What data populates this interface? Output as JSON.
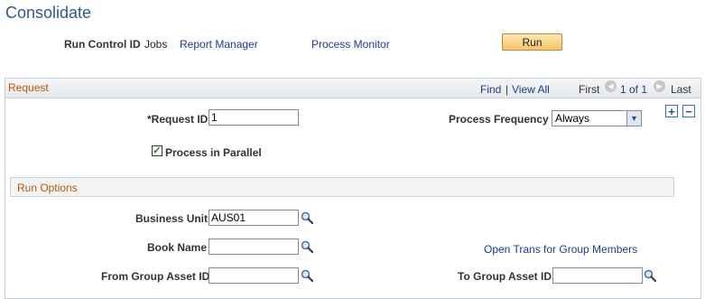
{
  "page": {
    "title": "Consolidate"
  },
  "run_bar": {
    "run_control_label": "Run Control ID",
    "run_control_value": "Jobs",
    "report_manager": "Report Manager",
    "process_monitor": "Process Monitor",
    "run_button": "Run"
  },
  "grid": {
    "title": "Request",
    "find": "Find",
    "separator": "|",
    "view_all": "View All",
    "first": "First",
    "range": "1 of 1",
    "last": "Last",
    "add_row": "+",
    "delete_row": "−"
  },
  "request": {
    "request_id_label": "*Request ID",
    "request_id_value": "1",
    "frequency_label": "Process Frequency",
    "frequency_value": "Always",
    "parallel_label": "Process in Parallel",
    "parallel_checked": true
  },
  "run_options": {
    "title": "Run Options",
    "business_unit_label": "Business Unit",
    "business_unit_value": "AUS01",
    "book_name_label": "Book Name",
    "book_name_value": "",
    "open_trans_link": "Open Trans for Group Members",
    "from_group_label": "From Group Asset ID",
    "from_group_value": "",
    "to_group_label": "To Group Asset ID",
    "to_group_value": ""
  },
  "icons": {
    "lookup": "magnifier-icon",
    "prev": "left-arrow-icon",
    "next": "right-arrow-icon",
    "dropdown": "chevron-down-icon",
    "check": "checkmark-icon"
  },
  "colors": {
    "title": "#2e5a87",
    "section_title": "#b8560e",
    "link": "#1a3f82",
    "run_button": "#f6c46a"
  }
}
